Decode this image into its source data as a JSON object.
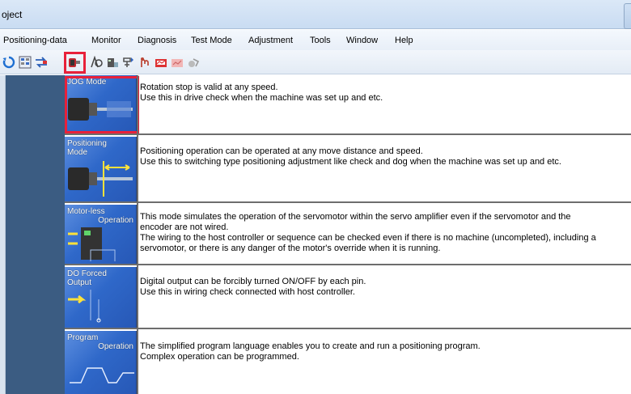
{
  "window": {
    "title_fragment": "oject"
  },
  "menu": [
    "Positioning-data",
    "Monitor",
    "Diagnosis",
    "Test Mode",
    "Adjustment",
    "Tools",
    "Window",
    "Help"
  ],
  "toolbar_icons": [
    "refresh-icon",
    "parameter-list-icon",
    "transfer-icon",
    "jog-mode-icon",
    "positioning-mode-icon",
    "motorless-operation-icon",
    "do-forced-output-icon",
    "program-operation-icon",
    "machine-analyzer-icon",
    "one-touch-tuning-icon",
    "advanced-tuning-icon"
  ],
  "highlight_color": "#e8213a",
  "modes": [
    {
      "name": "JOG Mode",
      "name2": "",
      "lines": [
        "Rotation stop is valid at any speed.",
        "Use this in drive check when the machine was set up and etc."
      ]
    },
    {
      "name": "Positioning Mode",
      "name2": "",
      "lines": [
        "Positioning operation can be operated at any move distance and speed.",
        "Use this to switching type positioning adjustment like check and dog when the machine was set up and etc."
      ]
    },
    {
      "name": "Motor-less",
      "name2": "Operation",
      "lines": [
        "This mode simulates the operation of the servomotor within the servo amplifier even if the servomotor and the",
        "encoder are not wired.",
        "The wiring to the host controller or sequence can be checked even if there is no machine (uncompleted), including a",
        "servomotor, or there is any danger of the motor's override when it is running."
      ]
    },
    {
      "name": "DO Forced Output",
      "name2": "",
      "lines": [
        "Digital output can be forcibly turned ON/OFF by each pin.",
        "Use this in wiring check connected with host controller."
      ]
    },
    {
      "name": "Program",
      "name2": "Operation",
      "lines": [
        "The simplified program language enables you to create and run a positioning program.",
        "Complex operation can be programmed."
      ]
    }
  ]
}
